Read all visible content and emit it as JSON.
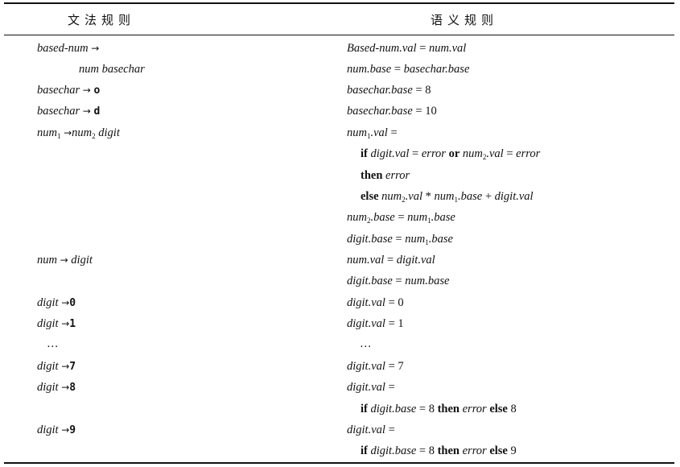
{
  "header": {
    "grammar": "文法规则",
    "semantic": "语义规则"
  },
  "rows": {
    "r1": {
      "g": "based-num →",
      "s": "Based-num.val = num.val"
    },
    "r2": {
      "g": "num basechar",
      "s": "num.base = basechar.base"
    },
    "r3": {
      "g_a": "basechar",
      "g_b": "o",
      "s": "basechar.base = 8"
    },
    "r4": {
      "g_a": "basechar",
      "g_b": "d",
      "s": "basechar.base = 10"
    },
    "r5": {
      "g": "num1 →num2 digit",
      "s": "num1.val ="
    },
    "r6": {
      "s": "if digit.val = error or num2.val = error"
    },
    "r7": {
      "s": "then error"
    },
    "r8": {
      "s": "else num2.val * num1.base + digit.val"
    },
    "r9": {
      "s": "num2.base = num1.base"
    },
    "r10": {
      "s": "digit.base = num1.base"
    },
    "r11": {
      "g": "num → digit",
      "s": "num.val = digit.val"
    },
    "r12": {
      "s": "digit.base = num.base"
    },
    "r13": {
      "g_a": "digit",
      "g_b": "0",
      "s": "digit.val = 0"
    },
    "r14": {
      "g_a": "digit",
      "g_b": "1",
      "s": "digit.val = 1"
    },
    "r15": {
      "g": "…",
      "s": "…"
    },
    "r16": {
      "g_a": "digit",
      "g_b": "7",
      "s": "digit.val = 7"
    },
    "r17": {
      "g_a": "digit",
      "g_b": "8",
      "s": "digit.val ="
    },
    "r18": {
      "s": "if digit.base = 8 then error else 8"
    },
    "r19": {
      "g_a": "digit",
      "g_b": "9",
      "s": "digit.val ="
    },
    "r20": {
      "s": "if digit.base = 8 then error else 9"
    }
  }
}
